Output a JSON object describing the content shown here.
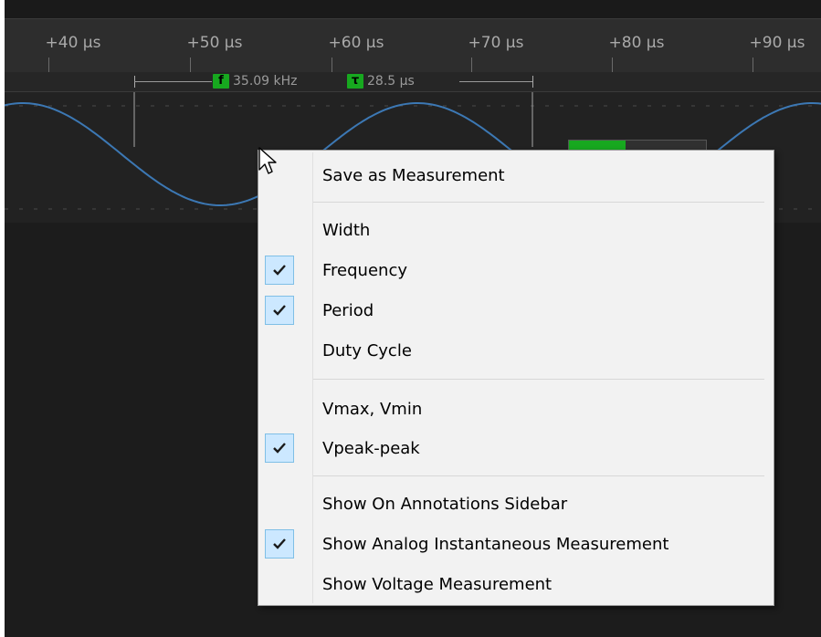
{
  "timeline": {
    "ticks": [
      "+40 µs",
      "+50 µs",
      "+60 µs",
      "+70 µs",
      "+80 µs",
      "+90 µs"
    ]
  },
  "measurement": {
    "frequency_tag": "f",
    "frequency_value": "35.09 kHz",
    "period_tag": "τ",
    "period_value": "28.5 µs"
  },
  "colors": {
    "waveform": "#3c78b4",
    "tag_green": "#17a81f",
    "menu_bg": "#f2f2f2",
    "check_bg": "#cce8ff"
  },
  "context_menu": {
    "items": [
      {
        "label": "Save as Measurement",
        "checked": false
      },
      {
        "label": "Width",
        "checked": false
      },
      {
        "label": "Frequency",
        "checked": true
      },
      {
        "label": "Period",
        "checked": true
      },
      {
        "label": "Duty Cycle",
        "checked": false
      },
      {
        "label": "Vmax, Vmin",
        "checked": false
      },
      {
        "label": "Vpeak-peak",
        "checked": true
      },
      {
        "label": "Show On Annotations Sidebar",
        "checked": false
      },
      {
        "label": "Show Analog Instantaneous Measurement",
        "checked": true
      },
      {
        "label": "Show Voltage Measurement",
        "checked": false
      }
    ]
  }
}
